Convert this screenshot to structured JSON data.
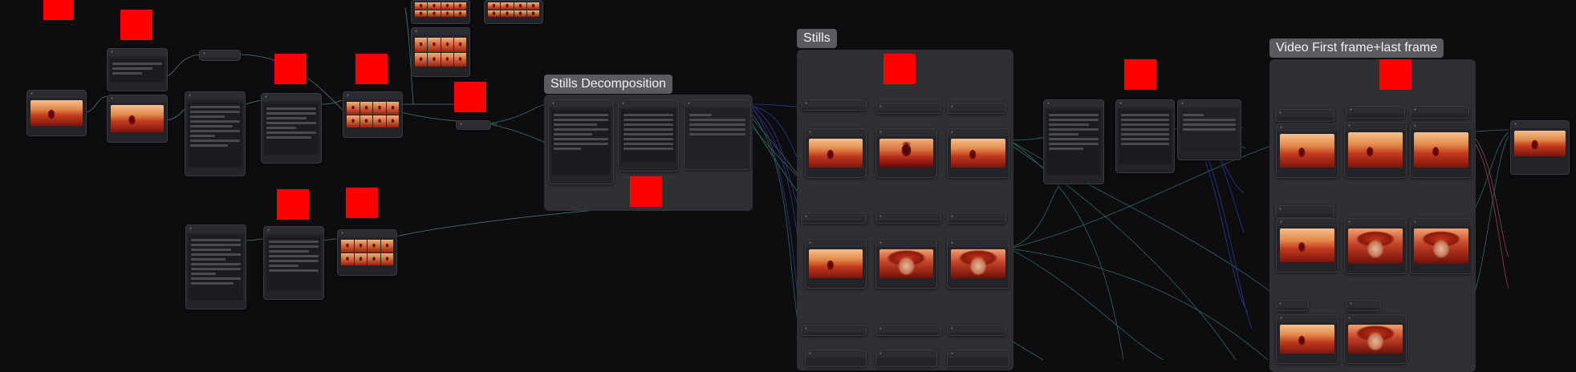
{
  "groups": {
    "stills_decomposition": "Stills Decomposition",
    "stills": "Stills",
    "video_first_last": "Video First frame+last frame"
  },
  "colors": {
    "canvas": "#0d0d10",
    "group_bg": "#2f3034",
    "group_title_bg": "#5a5b60",
    "marker": "#ff0000",
    "wire_green": "#3f8f7e",
    "wire_blue": "#3b49c9"
  },
  "icons": {
    "node_collapse": "dot-icon"
  }
}
